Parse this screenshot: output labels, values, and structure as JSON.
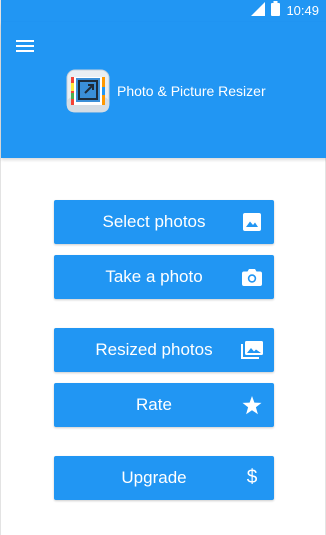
{
  "status_bar": {
    "time": "10:49",
    "icons": [
      "signal-icon",
      "battery-icon"
    ]
  },
  "header": {
    "menu_icon": "hamburger-menu-icon",
    "app_title": "Photo & Picture Resizer",
    "logo_icon": "resize-frame-icon"
  },
  "buttons": [
    {
      "label": "Select photos",
      "icon": "image-icon"
    },
    {
      "label": "Take a photo",
      "icon": "camera-icon"
    },
    {
      "label": "Resized photos",
      "icon": "photo-library-icon"
    },
    {
      "label": "Rate",
      "icon": "star-icon"
    },
    {
      "label": "Upgrade",
      "icon": "dollar-icon",
      "icon_glyph": "$"
    }
  ],
  "colors": {
    "primary": "#2196f3",
    "on_primary": "#ffffff",
    "background": "#ffffff"
  }
}
